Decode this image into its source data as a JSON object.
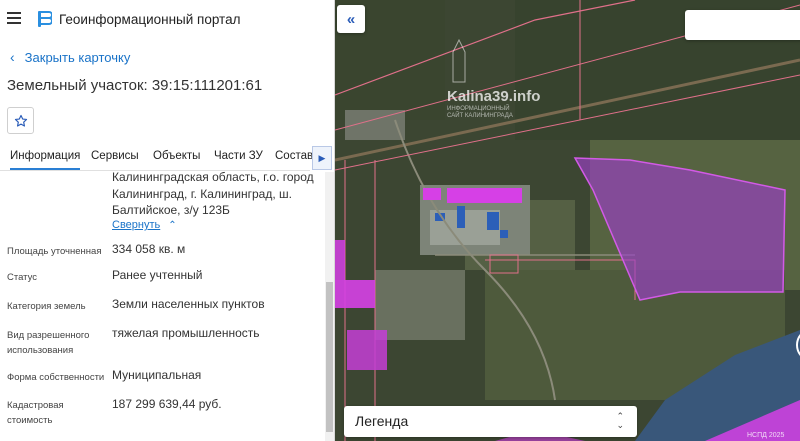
{
  "header": {
    "title": "Геоинформационный портал"
  },
  "card": {
    "back_label": "Закрыть карточку",
    "title": "Земельный участок: 39:15:111201:61"
  },
  "tabs": [
    {
      "label": "Информация",
      "active": true
    },
    {
      "label": "Сервисы"
    },
    {
      "label": "Объекты"
    },
    {
      "label": "Части ЗУ"
    },
    {
      "label": "Состав"
    }
  ],
  "info": {
    "address": "Калининградская область, г.о. город Калининград, г. Калининград, ш. Балтийское, з/у 123Б",
    "collapse_label": "Свернуть",
    "rows": [
      {
        "label": "Площадь уточненная",
        "value": "334 058 кв. м"
      },
      {
        "label": "Статус",
        "value": "Ранее учтенный"
      },
      {
        "label": "Категория земель",
        "value": "Земли населенных пунктов"
      },
      {
        "label": "Вид разрешенного использования",
        "value": "тяжелая промышленность"
      },
      {
        "label": "Форма собственности",
        "value": "Муниципальная"
      },
      {
        "label": "Кадастровая стоимость",
        "value": "187 299 639,44 руб."
      }
    ]
  },
  "map": {
    "watermark": "Kalina39.info",
    "watermark_sub": "ИНФОРМАЦИОННЫЙ САЙТ КАЛИНИНГРАДА",
    "legend_label": "Легенда",
    "attribution": "НСПД 2025",
    "colors": {
      "highlight": "#c042e6",
      "cadastre_line": "#e0708a",
      "accent": "#2a5cb8"
    }
  }
}
